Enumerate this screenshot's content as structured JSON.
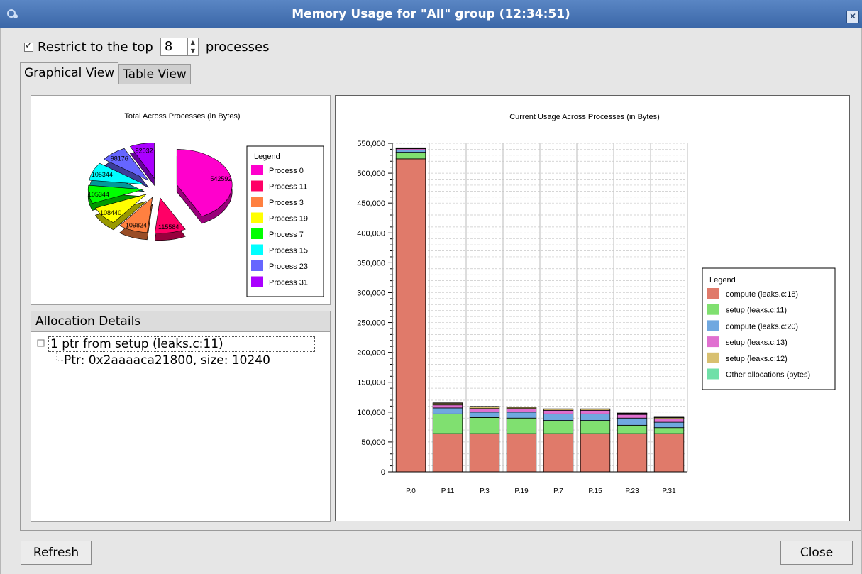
{
  "window": {
    "title": "Memory Usage for \"All\" group (12:34:51)"
  },
  "toolbar": {
    "restrict_label": "Restrict to the top",
    "top_count": "8",
    "processes_label": "processes"
  },
  "tabs": [
    "Graphical View",
    "Table View"
  ],
  "allocation": {
    "header": "Allocation Details",
    "row1": "1 ptr from setup (leaks.c:11)",
    "row2": "Ptr: 0x2aaaaca21800, size: 10240"
  },
  "buttons": {
    "refresh": "Refresh",
    "close": "Close"
  },
  "chart_data": [
    {
      "type": "pie",
      "title": "Total Across Processes (in Bytes)",
      "legend_title": "Legend",
      "legend_position": "right",
      "categories": [
        "Process 0",
        "Process 11",
        "Process 3",
        "Process 19",
        "Process 7",
        "Process 15",
        "Process 23",
        "Process 31"
      ],
      "values": [
        542592,
        115584,
        109824,
        108440,
        105344,
        105344,
        98176,
        92032
      ],
      "slice_labels": [
        "542592",
        "115584",
        "109824",
        "108440",
        "105344",
        "105344",
        "98176",
        "92032"
      ],
      "colors": [
        "#ff00cc",
        "#ff0066",
        "#ff8040",
        "#ffff00",
        "#00ff00",
        "#00ffff",
        "#6666ff",
        "#aa00ff"
      ]
    },
    {
      "type": "bar",
      "stacked": true,
      "title": "Current Usage Across Processes (in Bytes)",
      "legend_title": "Legend",
      "legend_position": "right",
      "categories": [
        "P.0",
        "P.11",
        "P.3",
        "P.19",
        "P.7",
        "P.15",
        "P.23",
        "P.31"
      ],
      "ylim": [
        0,
        550000
      ],
      "yticks": [
        "0",
        "50,000",
        "100,000",
        "150,000",
        "200,000",
        "250,000",
        "300,000",
        "350,000",
        "400,000",
        "450,000",
        "500,000",
        "550,000"
      ],
      "grid": true,
      "series": [
        {
          "name": "compute (leaks.c:18)",
          "color": "#e07a6a",
          "values": [
            524000,
            64000,
            64000,
            64000,
            64000,
            64000,
            64000,
            64000
          ]
        },
        {
          "name": "setup (leaks.c:11)",
          "color": "#80e070",
          "values": [
            11000,
            33000,
            27000,
            26000,
            22000,
            22000,
            14000,
            10000
          ]
        },
        {
          "name": "compute (leaks.c:20)",
          "color": "#70a8e0",
          "values": [
            4000,
            10000,
            9000,
            10000,
            11000,
            11000,
            12000,
            9000
          ]
        },
        {
          "name": "setup (leaks.c:13)",
          "color": "#e070d0",
          "values": [
            2000,
            5000,
            6000,
            6000,
            6000,
            6000,
            6000,
            6000
          ]
        },
        {
          "name": "setup (leaks.c:12)",
          "color": "#d8c070",
          "values": [
            1000,
            3000,
            3000,
            2000,
            2000,
            2000,
            2000,
            2000
          ]
        },
        {
          "name": "Other allocations (bytes)",
          "color": "#70e0a8",
          "values": [
            500,
            500,
            500,
            500,
            500,
            500,
            500,
            500
          ]
        }
      ]
    }
  ]
}
